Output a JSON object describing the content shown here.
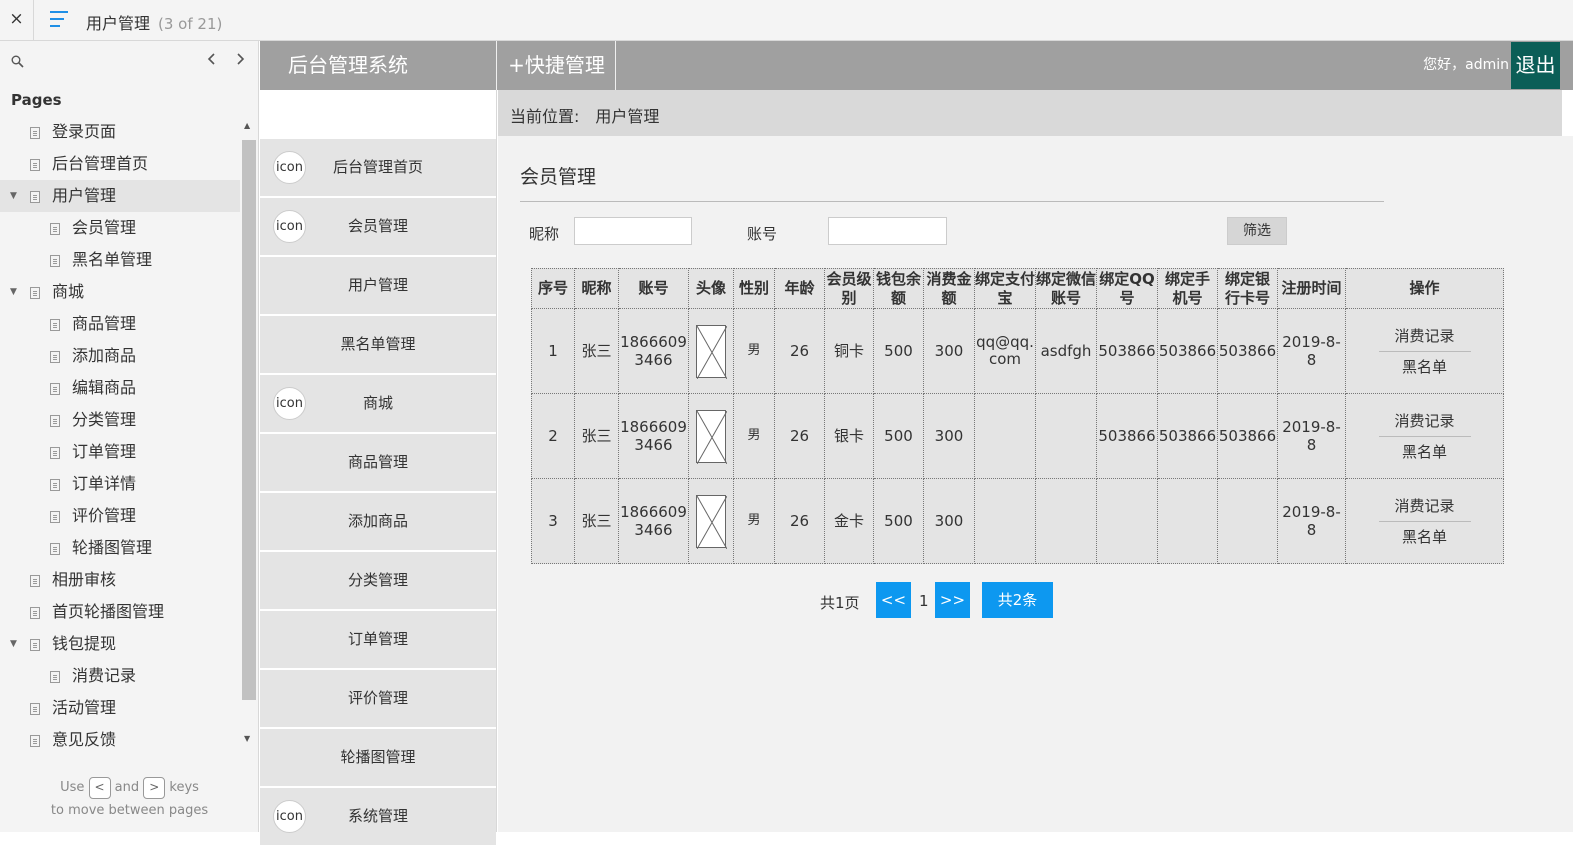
{
  "viewer": {
    "close_icon": "×",
    "page_title": "用户管理",
    "page_count": "(3 of 21)"
  },
  "sitemap": {
    "heading": "Pages",
    "items": [
      {
        "label": "登录页面",
        "level": 1,
        "expandable": false,
        "selected": false
      },
      {
        "label": "后台管理首页",
        "level": 1,
        "expandable": false,
        "selected": false
      },
      {
        "label": "用户管理",
        "level": 1,
        "expandable": true,
        "selected": true
      },
      {
        "label": "会员管理",
        "level": 2,
        "expandable": false,
        "selected": false
      },
      {
        "label": "黑名单管理",
        "level": 2,
        "expandable": false,
        "selected": false
      },
      {
        "label": "商城",
        "level": 1,
        "expandable": true,
        "selected": false
      },
      {
        "label": "商品管理",
        "level": 2,
        "expandable": false,
        "selected": false
      },
      {
        "label": "添加商品",
        "level": 2,
        "expandable": false,
        "selected": false
      },
      {
        "label": "编辑商品",
        "level": 2,
        "expandable": false,
        "selected": false
      },
      {
        "label": "分类管理",
        "level": 2,
        "expandable": false,
        "selected": false
      },
      {
        "label": "订单管理",
        "level": 2,
        "expandable": false,
        "selected": false
      },
      {
        "label": "订单详情",
        "level": 2,
        "expandable": false,
        "selected": false
      },
      {
        "label": "评价管理",
        "level": 2,
        "expandable": false,
        "selected": false
      },
      {
        "label": "轮播图管理",
        "level": 2,
        "expandable": false,
        "selected": false
      },
      {
        "label": "相册审核",
        "level": 1,
        "expandable": false,
        "selected": false
      },
      {
        "label": "首页轮播图管理",
        "level": 1,
        "expandable": false,
        "selected": false
      },
      {
        "label": "钱包提现",
        "level": 1,
        "expandable": true,
        "selected": false
      },
      {
        "label": "消费记录",
        "level": 2,
        "expandable": false,
        "selected": false
      },
      {
        "label": "活动管理",
        "level": 1,
        "expandable": false,
        "selected": false
      },
      {
        "label": "意见反馈",
        "level": 1,
        "expandable": false,
        "selected": false
      }
    ],
    "hint_use": "Use",
    "hint_and": "and",
    "hint_keys": "keys",
    "hint_line2": "to move between pages",
    "key_prev": "<",
    "key_next": ">"
  },
  "app": {
    "brand": "后台管理系统",
    "quick": "+快捷管理",
    "greeting": "您好，admin",
    "logout": "退出"
  },
  "side_menu": [
    {
      "label": "后台管理首页",
      "icon": "icon"
    },
    {
      "label": "会员管理",
      "icon": "icon"
    },
    {
      "label": "用户管理",
      "icon": ""
    },
    {
      "label": "黑名单管理",
      "icon": ""
    },
    {
      "label": "商城",
      "icon": "icon"
    },
    {
      "label": "商品管理",
      "icon": ""
    },
    {
      "label": "添加商品",
      "icon": ""
    },
    {
      "label": "分类管理",
      "icon": ""
    },
    {
      "label": "订单管理",
      "icon": ""
    },
    {
      "label": "评价管理",
      "icon": ""
    },
    {
      "label": "轮播图管理",
      "icon": ""
    },
    {
      "label": "系统管理",
      "icon": "icon"
    }
  ],
  "breadcrumb": {
    "label": "当前位置:",
    "current": "用户管理"
  },
  "main": {
    "heading": "会员管理",
    "filter": {
      "nickname_label": "昵称",
      "nickname_value": "",
      "account_label": "账号",
      "account_value": "",
      "button": "筛选"
    },
    "table": {
      "headers": [
        "序号",
        "昵称",
        "账号",
        "头像",
        "性别",
        "年龄",
        "会员级别",
        "钱包余额",
        "消费金额",
        "绑定支付宝",
        "绑定微信账号",
        "绑定QQ号",
        "绑定手机号",
        "绑定银行卡号",
        "注册时间",
        "操作"
      ],
      "rows": [
        {
          "no": "1",
          "nick": "张三",
          "account": "18666093466",
          "gender": "男",
          "age": "26",
          "level": "铜卡",
          "balance": "500",
          "spent": "300",
          "alipay": "qq@qq.com",
          "wechat": "asdfgh",
          "qq": "503866",
          "phone": "503866",
          "bank": "503866",
          "date": "2019-8-8",
          "op1": "消费记录",
          "op2": "黑名单"
        },
        {
          "no": "2",
          "nick": "张三",
          "account": "18666093466",
          "gender": "男",
          "age": "26",
          "level": "银卡",
          "balance": "500",
          "spent": "300",
          "alipay": "",
          "wechat": "",
          "qq": "503866",
          "phone": "503866",
          "bank": "503866",
          "date": "2019-8-8",
          "op1": "消费记录",
          "op2": "黑名单"
        },
        {
          "no": "3",
          "nick": "张三",
          "account": "18666093466",
          "gender": "男",
          "age": "26",
          "level": "金卡",
          "balance": "500",
          "spent": "300",
          "alipay": "",
          "wechat": "",
          "qq": "",
          "phone": "",
          "bank": "",
          "date": "2019-8-8",
          "op1": "消费记录",
          "op2": "黑名单"
        }
      ]
    },
    "pager": {
      "total_pages": "共1页",
      "prev": "<<",
      "current": "1",
      "next": ">>",
      "total_items": "共2条"
    }
  },
  "colors": {
    "header_gray": "#a0a0a0",
    "logout_bg": "#0b5e57",
    "pager_blue": "#0d98f0",
    "menu_icon_blue": "#1f8fe6"
  }
}
